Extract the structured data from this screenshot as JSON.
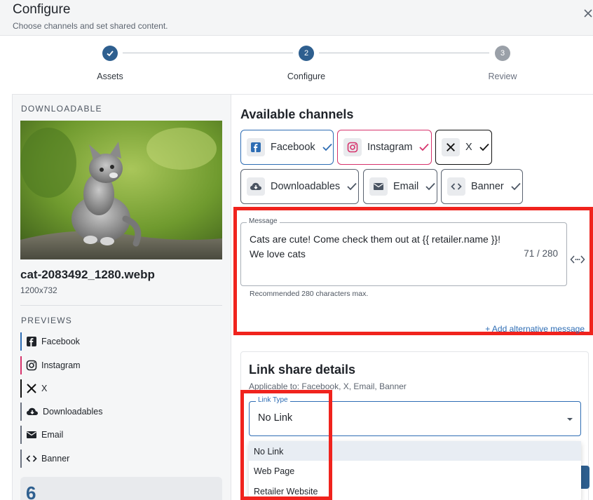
{
  "header": {
    "title": "Configure",
    "subtitle": "Choose channels and set shared content."
  },
  "stepper": {
    "steps": [
      {
        "num": "",
        "label": "Assets",
        "state": "done"
      },
      {
        "num": "2",
        "label": "Configure",
        "state": "active"
      },
      {
        "num": "3",
        "label": "Review",
        "state": "pending"
      }
    ]
  },
  "asset": {
    "section_label": "DOWNLOADABLE",
    "filename": "cat-2083492_1280.webp",
    "dimensions": "1200x732",
    "previews_label": "PREVIEWS",
    "previews": [
      "Facebook",
      "Instagram",
      "X",
      "Downloadables",
      "Email",
      "Banner"
    ],
    "count": "6"
  },
  "channels": {
    "title": "Available channels",
    "items": [
      {
        "label": "Facebook",
        "icon": "facebook-icon",
        "color": "#2e6db4"
      },
      {
        "label": "Instagram",
        "icon": "instagram-icon",
        "color": "#d6336c"
      },
      {
        "label": "X",
        "icon": "x-icon",
        "color": "#111111"
      },
      {
        "label": "Downloadables",
        "icon": "cloud-download-icon",
        "color": "#4b5563"
      },
      {
        "label": "Email",
        "icon": "email-icon",
        "color": "#4b5563"
      },
      {
        "label": "Banner",
        "icon": "code-icon",
        "color": "#4b5563"
      }
    ]
  },
  "message": {
    "label": "Message",
    "line1": "Cats are cute! Come check them out at {{ retailer.name }}!",
    "line2": "We love cats",
    "counter": "71 / 280",
    "helper": "Recommended 280 characters max.",
    "add_alt": "+ Add alternative message"
  },
  "link_share": {
    "title": "Link share details",
    "applicable": "Applicable to: Facebook, X, Email, Banner",
    "field_label": "Link Type",
    "value": "No Link",
    "options": [
      "No Link",
      "Web Page",
      "Retailer Website"
    ]
  },
  "colors": {
    "accent": "#2e5f8f",
    "highlight": "#f0231d"
  }
}
